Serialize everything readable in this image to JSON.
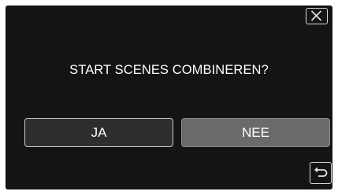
{
  "dialog": {
    "question": "START SCENES COMBINEREN?",
    "yes_label": "JA",
    "no_label": "NEE"
  },
  "icons": {
    "close": "close-icon",
    "back": "return-arrow-icon"
  },
  "colors": {
    "background": "#141414",
    "text": "#ffffff",
    "yes_button": "#2e2e2e",
    "no_button": "#6a6a6a",
    "border": "#d9d9d9"
  }
}
